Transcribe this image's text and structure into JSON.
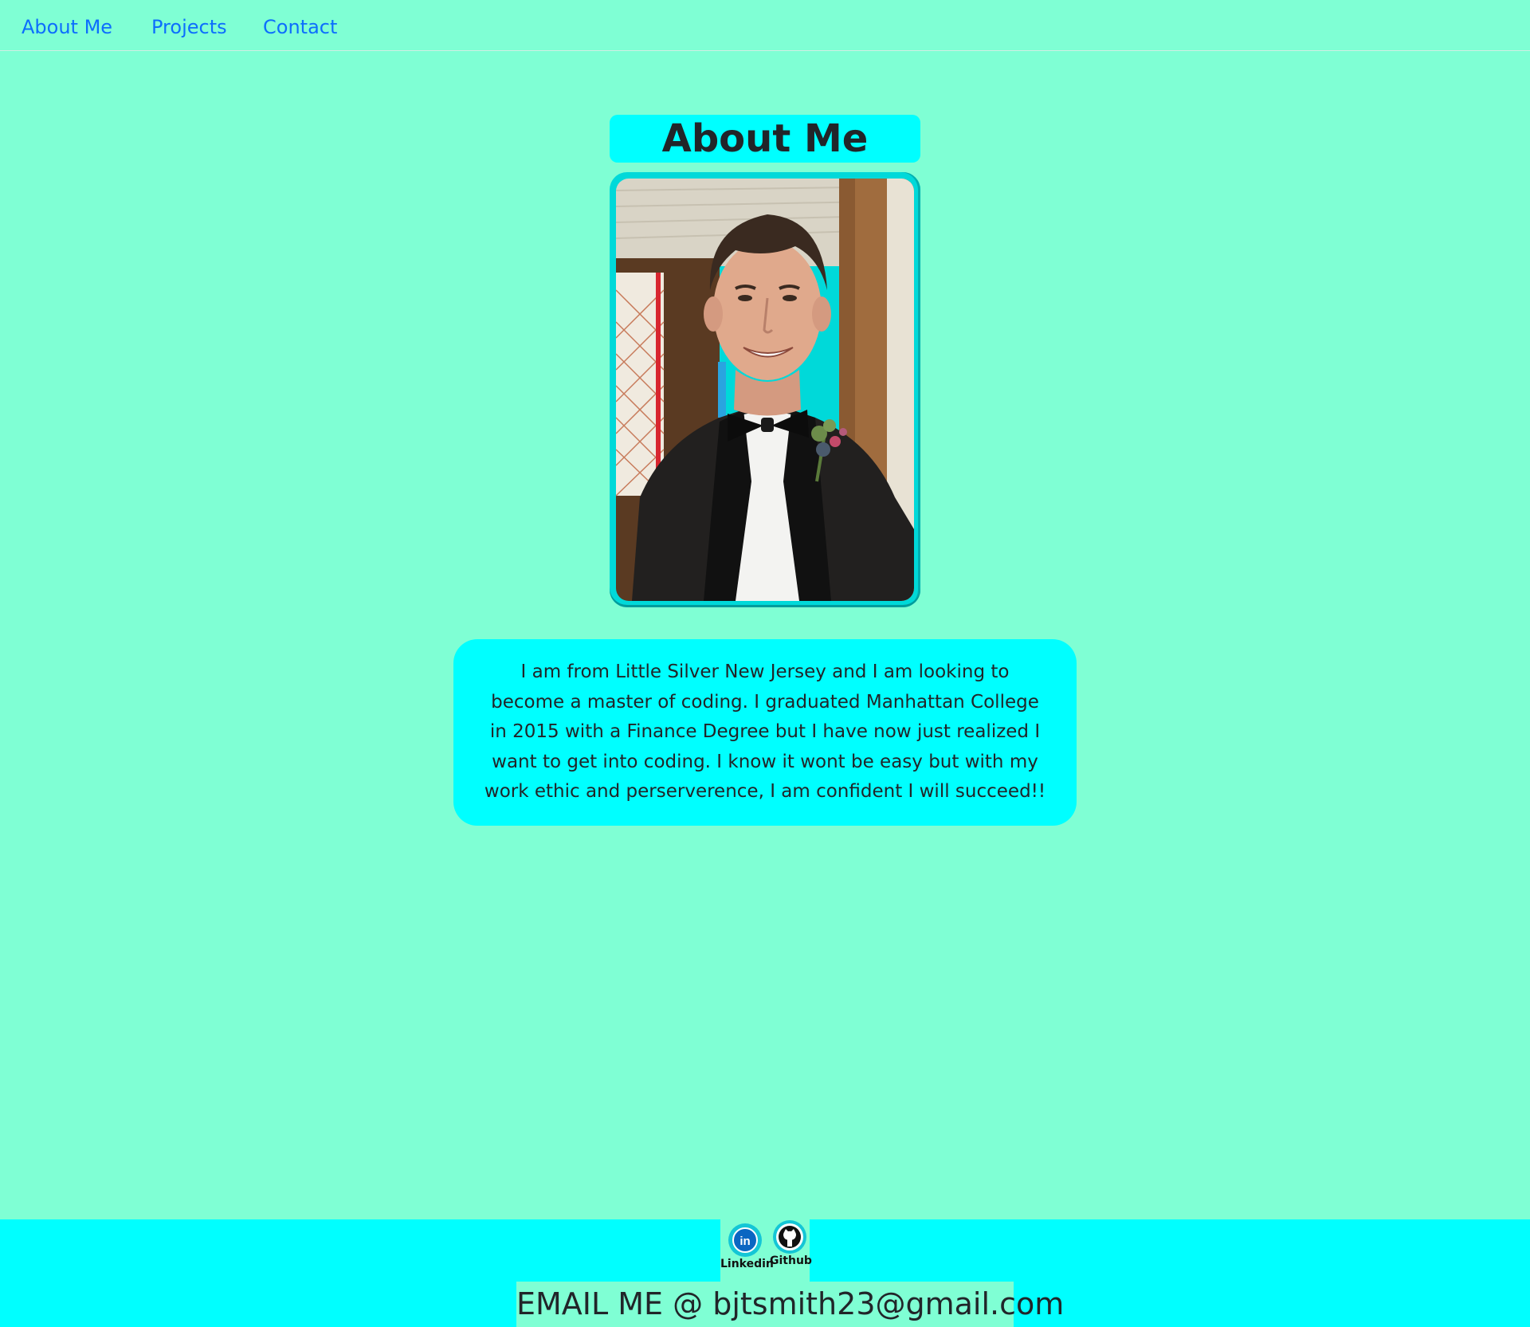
{
  "nav": {
    "items": [
      {
        "label": "About Me"
      },
      {
        "label": "Projects"
      },
      {
        "label": "Contact"
      }
    ]
  },
  "about": {
    "heading": "About Me",
    "bio": "I am from Little Silver New Jersey and I am looking to become a master of coding. I graduated Manhattan College in 2015 with a Finance Degree but I have now just realized I want to get into coding. I know it wont be easy but with my work ethic and perserverence, I am confident I will succeed!!"
  },
  "footer": {
    "social": [
      {
        "label": "Linkedin",
        "icon": "linkedin-icon"
      },
      {
        "label": "Github",
        "icon": "github-icon"
      }
    ],
    "email_text": "EMAIL ME @ bjtsmith23@gmail.com"
  },
  "colors": {
    "page_bg": "#7fffd4",
    "panel_bg": "#00ffff",
    "link": "#0d6efd"
  }
}
